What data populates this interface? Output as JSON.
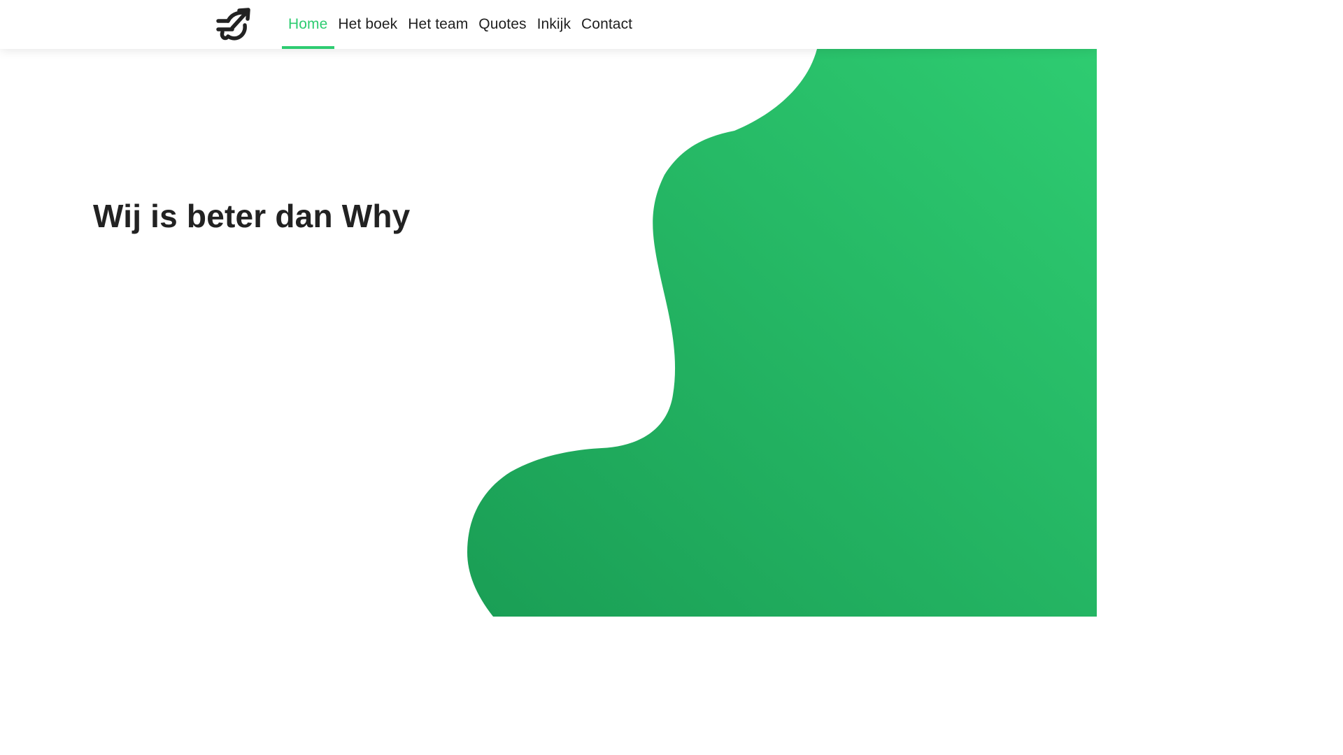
{
  "navbar": {
    "logo_icon": "rotating-arrow-logo-icon",
    "items": [
      {
        "label": "Home",
        "active": true
      },
      {
        "label": "Het boek",
        "active": false
      },
      {
        "label": "Het team",
        "active": false
      },
      {
        "label": "Quotes",
        "active": false
      },
      {
        "label": "Inkijk",
        "active": false
      },
      {
        "label": "Contact",
        "active": false
      }
    ]
  },
  "hero": {
    "title": "Wij is beter dan Why"
  },
  "colors": {
    "accent": "#2ecc71",
    "blob_light": "#2ecc71",
    "blob_dark": "#1a9e55",
    "text": "#222222"
  }
}
